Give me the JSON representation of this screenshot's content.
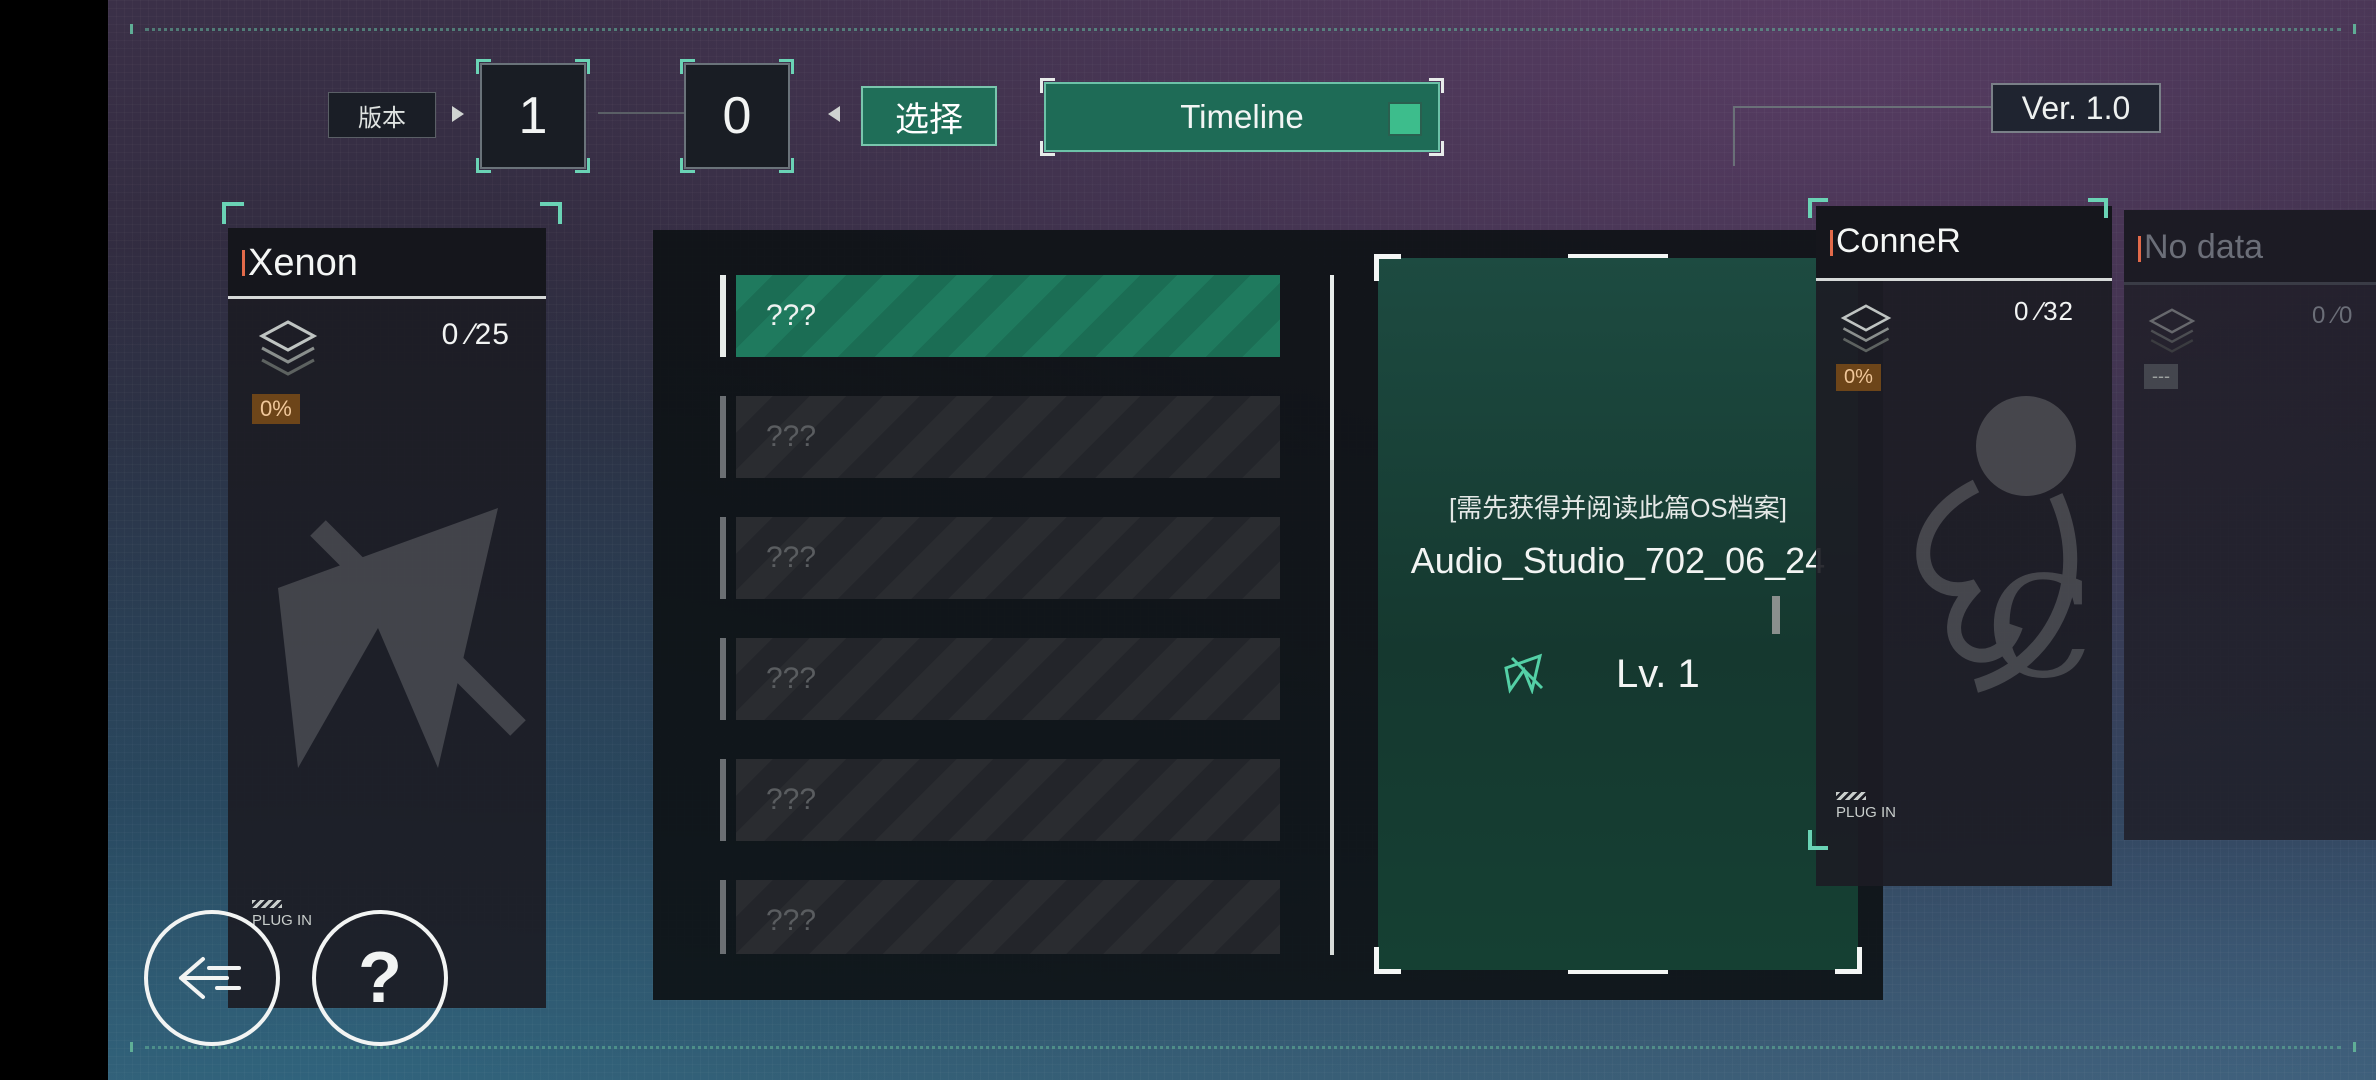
{
  "header": {
    "version_label": "版本",
    "major": "1",
    "minor": "0",
    "select_label": "选择",
    "timeline_label": "Timeline",
    "version_text": "Ver. 1.0"
  },
  "cards": [
    {
      "title": "Xenon",
      "count": "0 ∕25",
      "percent": "0%",
      "plugin": "PLUG IN"
    },
    {
      "title": "ConneR",
      "count": "0 ∕32",
      "percent": "0%",
      "plugin": "PLUG IN"
    },
    {
      "title": "No data",
      "count": "0 ∕0",
      "percent": "---"
    }
  ],
  "list": {
    "items": [
      "???",
      "???",
      "???",
      "???",
      "???",
      "???"
    ],
    "active_index": 0
  },
  "detail": {
    "note": "[需先获得并阅读此篇OS档案]",
    "name": "Audio_Studio_702_06_24",
    "level": "Lv. 1"
  },
  "buttons": {
    "back_icon": "back-arrow-icon",
    "help_label": "?"
  },
  "colors": {
    "accent": "#1e6b56",
    "corner": "#6ad3b5",
    "percent_bg": "#6d4519"
  }
}
